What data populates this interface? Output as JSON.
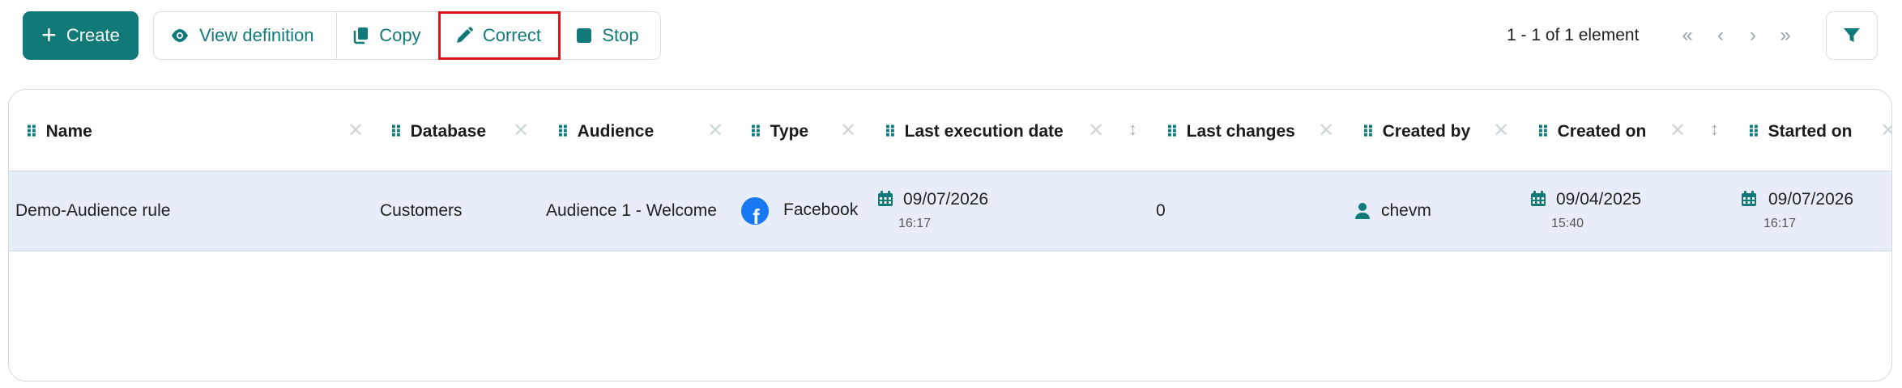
{
  "toolbar": {
    "create_label": "Create",
    "view_definition_label": "View definition",
    "copy_label": "Copy",
    "correct_label": "Correct",
    "stop_label": "Stop"
  },
  "pagination": {
    "text": "1 - 1 of 1 element",
    "first_icon": "«",
    "prev_icon": "‹",
    "next_icon": "›",
    "last_icon": "»"
  },
  "columns": [
    {
      "label": "Name"
    },
    {
      "label": "Database"
    },
    {
      "label": "Audience"
    },
    {
      "label": "Type"
    },
    {
      "label": "Last execution date"
    },
    {
      "label": "Last changes"
    },
    {
      "label": "Created by"
    },
    {
      "label": "Created on"
    },
    {
      "label": "Started on"
    }
  ],
  "rows": [
    {
      "name": "Demo-Audience rule",
      "database": "Customers",
      "audience": "Audience 1 - Welcome",
      "type": "Facebook",
      "last_execution_date": "09/07/2026",
      "last_execution_time": "16:17",
      "last_changes": "0",
      "created_by": "chevm",
      "created_on_date": "09/04/2025",
      "created_on_time": "15:40",
      "started_on_date": "09/07/2026",
      "started_on_time": "16:17"
    }
  ],
  "colors": {
    "accent": "#117a78",
    "highlight": "#e0141b",
    "row_background": "#e8eef9",
    "facebook": "#1877f2"
  }
}
